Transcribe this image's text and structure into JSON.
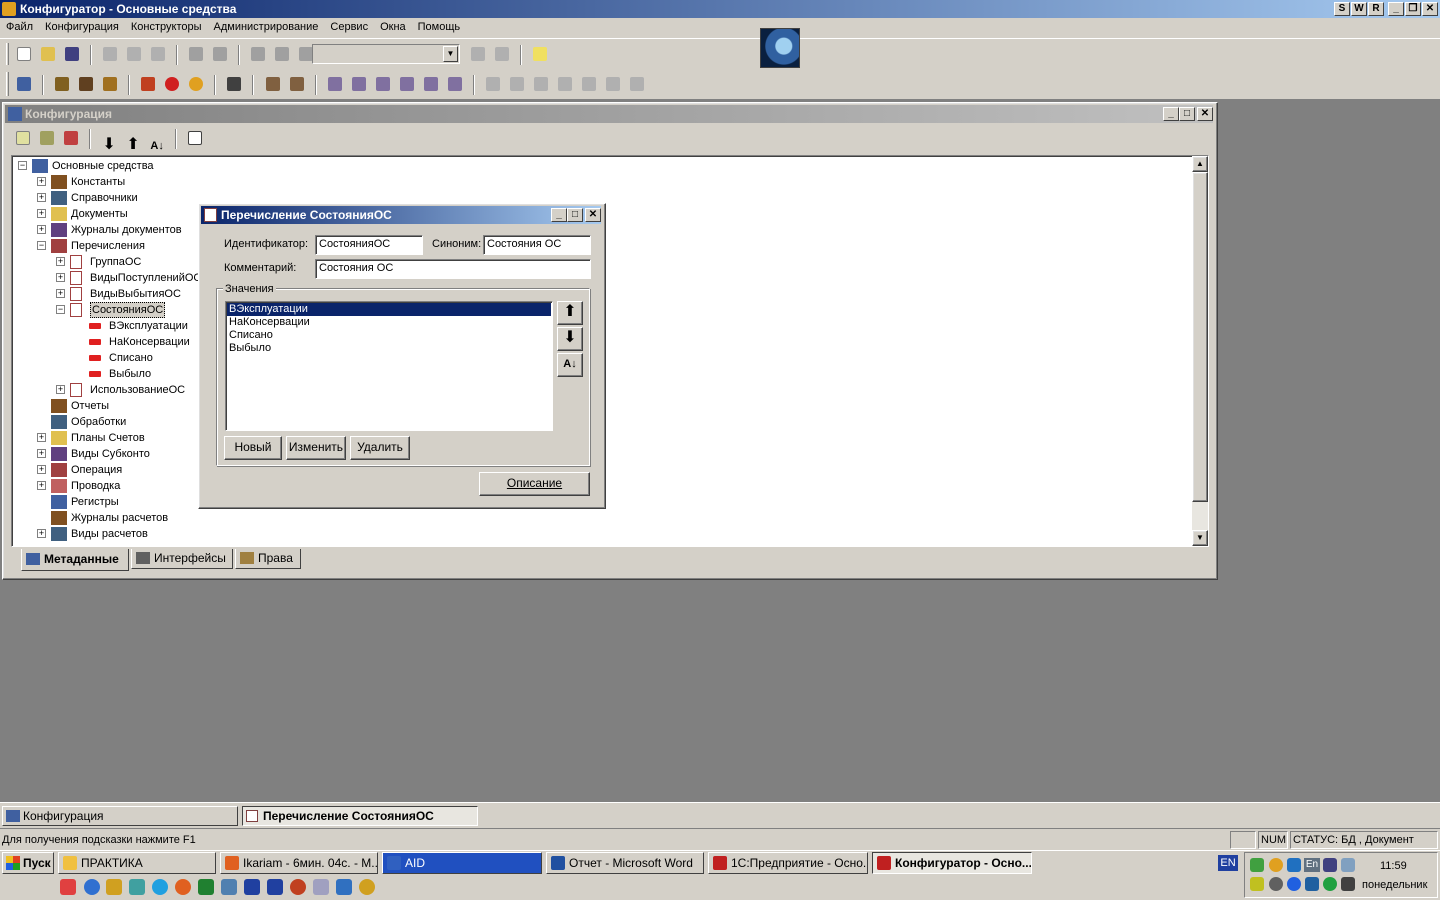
{
  "app": {
    "title": "Конфигуратор - Основные средства",
    "title_buttons": [
      "S",
      "W",
      "R"
    ]
  },
  "menu": [
    "Файл",
    "Конфигурация",
    "Конструкторы",
    "Администрирование",
    "Сервис",
    "Окна",
    "Помощь"
  ],
  "config_window": {
    "title": "Конфигурация",
    "tabs": [
      "Метаданные",
      "Интерфейсы",
      "Права"
    ]
  },
  "tree": [
    {
      "label": "Основные средства",
      "exp": "−",
      "level": 0
    },
    {
      "label": "Константы",
      "exp": "+",
      "level": 1
    },
    {
      "label": "Справочники",
      "exp": "+",
      "level": 1
    },
    {
      "label": "Документы",
      "exp": "+",
      "level": 1
    },
    {
      "label": "Журналы документов",
      "exp": "+",
      "level": 1
    },
    {
      "label": "Перечисления",
      "exp": "−",
      "level": 1
    },
    {
      "label": "ГруппаОС",
      "exp": "+",
      "level": 2
    },
    {
      "label": "ВидыПоступленийОС",
      "exp": "+",
      "level": 2
    },
    {
      "label": "ВидыВыбытияОС",
      "exp": "+",
      "level": 2
    },
    {
      "label": "СостоянияОС",
      "exp": "−",
      "level": 2,
      "selected": true
    },
    {
      "label": "ВЭксплуатации",
      "exp": "",
      "level": 3
    },
    {
      "label": "НаКонсервации",
      "exp": "",
      "level": 3
    },
    {
      "label": "Списано",
      "exp": "",
      "level": 3
    },
    {
      "label": "Выбыло",
      "exp": "",
      "level": 3
    },
    {
      "label": "ИспользованиеОС",
      "exp": "+",
      "level": 2
    },
    {
      "label": "Отчеты",
      "exp": "",
      "level": 1
    },
    {
      "label": "Обработки",
      "exp": "",
      "level": 1
    },
    {
      "label": "Планы Счетов",
      "exp": "+",
      "level": 1
    },
    {
      "label": "Виды Субконто",
      "exp": "+",
      "level": 1
    },
    {
      "label": "Операция",
      "exp": "+",
      "level": 1
    },
    {
      "label": "Проводка",
      "exp": "+",
      "level": 1
    },
    {
      "label": "Регистры",
      "exp": "",
      "level": 1
    },
    {
      "label": "Журналы расчетов",
      "exp": "",
      "level": 1
    },
    {
      "label": "Виды расчетов",
      "exp": "+",
      "level": 1
    }
  ],
  "dialog": {
    "title": "Перечисление СостоянияОС",
    "identifier_label": "Идентификатор:",
    "identifier_value": "СостоянияОС",
    "synonym_label": "Синоним:",
    "synonym_value": "Состояния ОС",
    "comment_label": "Комментарий:",
    "comment_value": "Состояния ОС",
    "values_group_label": "Значения",
    "values": [
      "ВЭксплуатации",
      "НаКонсервации",
      "Списано",
      "Выбыло"
    ],
    "new_button": "Новый",
    "edit_button": "Изменить",
    "delete_button": "Удалить",
    "description_button": "Описание"
  },
  "mdi_tabs": [
    "Конфигурация",
    "Перечисление СостоянияОС"
  ],
  "status": {
    "hint": "Для получения подсказки нажмите F1",
    "num": "NUM",
    "db": "СТАТУС: БД , Документ"
  },
  "taskbar": {
    "start": "Пуск",
    "items": [
      {
        "label": "ПРАКТИКА",
        "color": "#f0c040"
      },
      {
        "label": "Ikariam - 6мин. 04с. - M...",
        "color": "#e06020"
      },
      {
        "label": "AID",
        "color": "#3060c0"
      },
      {
        "label": "Отчет - Microsoft Word",
        "color": "#2050a0"
      },
      {
        "label": "1С:Предприятие - Осно...",
        "color": "#c02020"
      },
      {
        "label": "Конфигуратор - Осно...",
        "color": "#c02020"
      }
    ],
    "lang": "EN",
    "lang_tray": "En",
    "clock": "11:59",
    "day": "понедельник"
  }
}
